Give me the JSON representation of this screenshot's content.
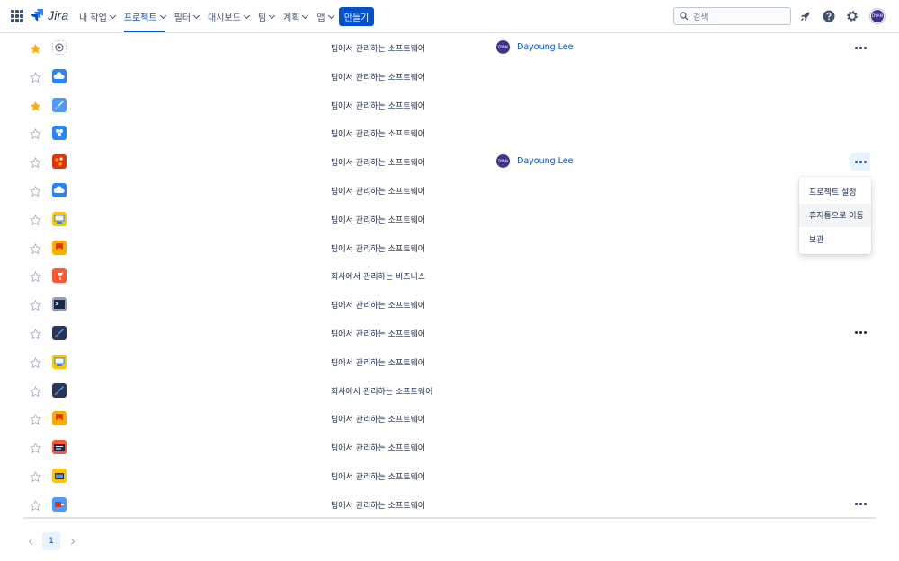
{
  "app": {
    "logo_text": "Jira",
    "brand_color": "#0052cc"
  },
  "nav": {
    "items": [
      {
        "label": "내 작업",
        "active": false
      },
      {
        "label": "프로젝트",
        "active": true
      },
      {
        "label": "필터",
        "active": false
      },
      {
        "label": "대시보드",
        "active": false
      },
      {
        "label": "팀",
        "active": false
      },
      {
        "label": "계획",
        "active": false
      },
      {
        "label": "앱",
        "active": false
      }
    ],
    "create_label": "만들기"
  },
  "search": {
    "placeholder": "검색"
  },
  "user": {
    "initials": "DYAN"
  },
  "projects": [
    {
      "starred": true,
      "icon": "target-icon",
      "type": "팀에서 관리하는 소프트웨어",
      "lead": "Dayoung Lee",
      "lead_initials": "DYAN",
      "more": "visible"
    },
    {
      "starred": false,
      "icon": "cloud-icon",
      "type": "팀에서 관리하는 소프트웨어",
      "lead": "",
      "more": "hidden"
    },
    {
      "starred": true,
      "icon": "rocket-blue-icon",
      "type": "팀에서 관리하는 소프트웨어",
      "lead": "",
      "more": "hidden"
    },
    {
      "starred": false,
      "icon": "puzzle-icon",
      "type": "팀에서 관리하는 소프트웨어",
      "lead": "",
      "more": "hidden"
    },
    {
      "starred": false,
      "icon": "molecule-icon",
      "type": "팀에서 관리하는 소프트웨어",
      "lead": "Dayoung Lee",
      "lead_initials": "DYAN",
      "more": "open"
    },
    {
      "starred": false,
      "icon": "cloud-icon",
      "type": "팀에서 관리하는 소프트웨어",
      "lead": "",
      "more": "hidden"
    },
    {
      "starred": false,
      "icon": "monitor-icon",
      "type": "팀에서 관리하는 소프트웨어",
      "lead": "",
      "more": "hidden"
    },
    {
      "starred": false,
      "icon": "flag-icon",
      "type": "팀에서 관리하는 소프트웨어",
      "lead": "",
      "more": "hidden"
    },
    {
      "starred": false,
      "icon": "wrench-icon",
      "type": "회사에서 관리하는 비즈니스",
      "lead": "",
      "more": "hidden"
    },
    {
      "starred": false,
      "icon": "terminal-icon",
      "type": "팀에서 관리하는 소프트웨어",
      "lead": "",
      "more": "hidden"
    },
    {
      "starred": false,
      "icon": "rocket-dark-icon",
      "type": "팀에서 관리하는 소프트웨어",
      "lead": "",
      "more": "visible"
    },
    {
      "starred": false,
      "icon": "monitor-icon",
      "type": "팀에서 관리하는 소프트웨어",
      "lead": "",
      "more": "hidden"
    },
    {
      "starred": false,
      "icon": "rocket-dark-icon",
      "type": "회사에서 관리하는 소프트웨어",
      "lead": "",
      "more": "hidden"
    },
    {
      "starred": false,
      "icon": "flag-icon",
      "type": "팀에서 관리하는 소프트웨어",
      "lead": "",
      "more": "hidden"
    },
    {
      "starred": false,
      "icon": "calendar-icon",
      "type": "팀에서 관리하는 소프트웨어",
      "lead": "",
      "more": "hidden"
    },
    {
      "starred": false,
      "icon": "folder-icon",
      "type": "팀에서 관리하는 소프트웨어",
      "lead": "",
      "more": "hidden"
    },
    {
      "starred": false,
      "icon": "screen-icon",
      "type": "팀에서 관리하는 소프트웨어",
      "lead": "",
      "more": "visible"
    }
  ],
  "dropdown": {
    "items": [
      "프로젝트 설정",
      "휴지통으로 이동",
      "보관"
    ],
    "hovered_index": 1
  },
  "pagination": {
    "current_page": "1"
  }
}
